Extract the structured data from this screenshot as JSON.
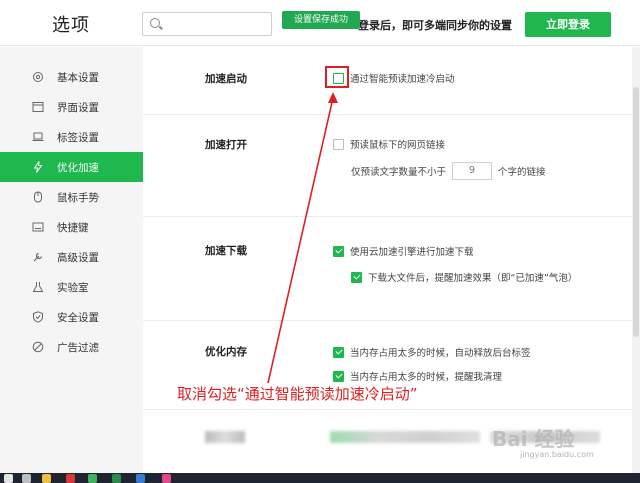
{
  "header": {
    "title": "选项",
    "search_placeholder": "",
    "toast": "设置保存成功",
    "login_tip": "登录后，即可多端同步你的设置",
    "login_button": "立即登录"
  },
  "sidebar": {
    "items": [
      {
        "label": "基本设置",
        "icon": "gear-icon",
        "active": false
      },
      {
        "label": "界面设置",
        "icon": "window-icon",
        "active": false
      },
      {
        "label": "标签设置",
        "icon": "tab-icon",
        "active": false
      },
      {
        "label": "优化加速",
        "icon": "lightning-icon",
        "active": true
      },
      {
        "label": "鼠标手势",
        "icon": "mouse-icon",
        "active": false
      },
      {
        "label": "快捷键",
        "icon": "keyboard-icon",
        "active": false
      },
      {
        "label": "高级设置",
        "icon": "wrench-icon",
        "active": false
      },
      {
        "label": "实验室",
        "icon": "lab-icon",
        "active": false
      },
      {
        "label": "安全设置",
        "icon": "shield-icon",
        "active": false
      },
      {
        "label": "广告过滤",
        "icon": "block-icon",
        "active": false
      }
    ]
  },
  "sections": {
    "boot": {
      "title": "加速启动",
      "option": {
        "label": "通过智能预读加速冷启动",
        "checked": false
      }
    },
    "open": {
      "title": "加速打开",
      "option": {
        "label": "预读鼠标下的网页链接",
        "checked": false
      },
      "min_chars_prefix": "仅预读文字数量不小于",
      "min_chars_value": "9",
      "min_chars_suffix": "个字的链接"
    },
    "download": {
      "title": "加速下载",
      "option1": {
        "label": "使用云加速引擎进行加速下载",
        "checked": true
      },
      "option2": {
        "label": "下载大文件后，提醒加速效果（即“已加速”气泡）",
        "checked": true
      }
    },
    "memory": {
      "title": "优化内存",
      "option1": {
        "label": "当内存占用太多的时候，自动释放后台标签",
        "checked": true
      },
      "option2": {
        "label": "当内存占用太多的时候，提醒我清理",
        "checked": true
      }
    }
  },
  "annotation": {
    "text": "取消勾选“通过智能预读加速冷启动”",
    "color": "#e02020"
  },
  "watermark": {
    "text": "Bai 经验",
    "sub": "jingyan.baidu.com"
  },
  "colors": {
    "accent": "#1fb84e",
    "annotation": "#e02020"
  }
}
